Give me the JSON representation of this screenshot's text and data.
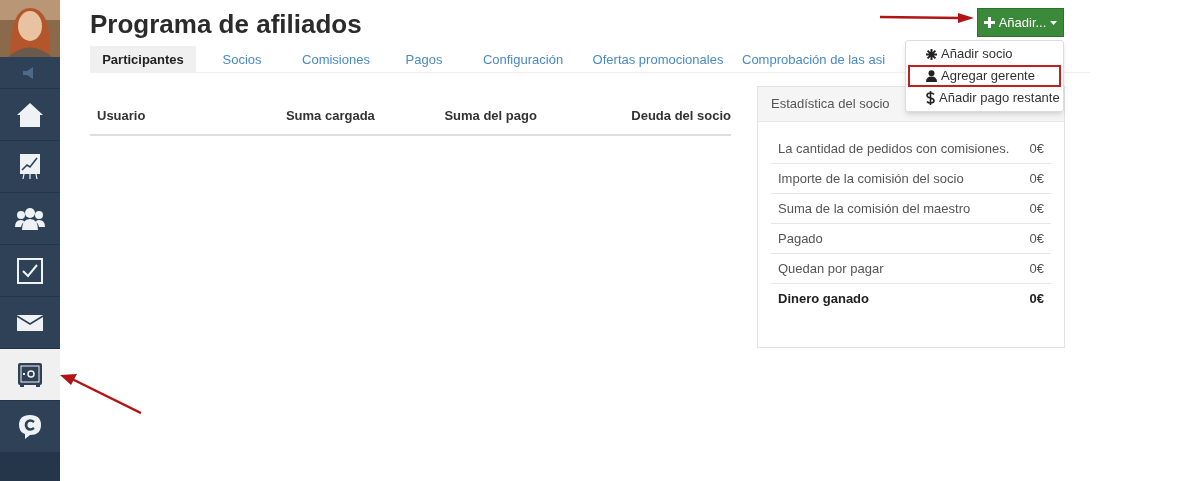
{
  "sidebar": {
    "items": [
      {
        "kind": "home",
        "selected": false
      },
      {
        "kind": "chart",
        "selected": false
      },
      {
        "kind": "people",
        "selected": false
      },
      {
        "kind": "tasks",
        "selected": false
      },
      {
        "kind": "mail",
        "selected": false
      },
      {
        "kind": "safe",
        "selected": true
      },
      {
        "kind": "chat",
        "selected": false
      }
    ]
  },
  "page": {
    "title": "Programa de afiliados"
  },
  "add_button": {
    "label": "Añadir...",
    "expanded": true
  },
  "dropdown": {
    "items": [
      {
        "kind": "asterisk",
        "label": "Añadir socio",
        "highlighted": false
      },
      {
        "kind": "user",
        "label": "Agregar gerente",
        "highlighted": true
      },
      {
        "kind": "dollar",
        "label": "Añadir pago restante",
        "highlighted": false
      }
    ]
  },
  "tabs": [
    {
      "label": "Participantes",
      "selected": true
    },
    {
      "label": "Socios",
      "selected": false
    },
    {
      "label": "Comisiones",
      "selected": false
    },
    {
      "label": "Pagos",
      "selected": false
    },
    {
      "label": "Configuración",
      "selected": false
    },
    {
      "label": "Ofertas promocionales",
      "selected": false
    },
    {
      "label": "Comprobación de las asi",
      "selected": false
    }
  ],
  "table": {
    "columns": [
      "Usuario",
      "Suma cargada",
      "Suma del pago",
      "Deuda del socio"
    ]
  },
  "stats": {
    "title": "Estadística del socio",
    "rows": [
      {
        "label": "La cantidad de pedidos con comisiones.",
        "value": "0€",
        "total": false
      },
      {
        "label": "Importe de la comisión del socio",
        "value": "0€",
        "total": false
      },
      {
        "label": "Suma de la comisión del maestro",
        "value": "0€",
        "total": false
      },
      {
        "label": "Pagado",
        "value": "0€",
        "total": false
      },
      {
        "label": "Quedan por pagar",
        "value": "0€",
        "total": false
      },
      {
        "label": "Dinero ganado",
        "value": "0€",
        "total": true
      }
    ]
  }
}
